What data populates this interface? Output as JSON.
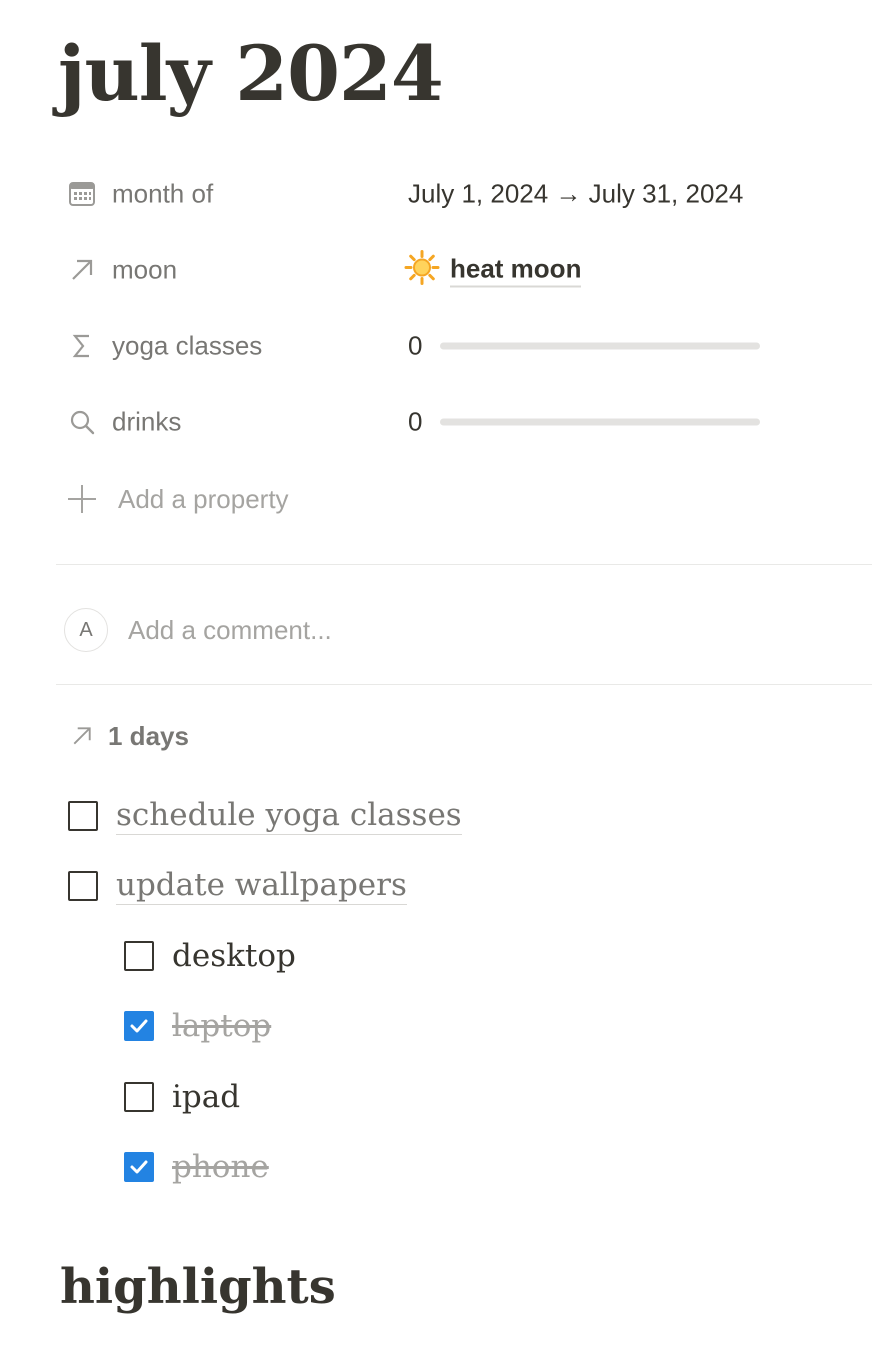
{
  "page": {
    "title": "july 2024"
  },
  "properties": [
    {
      "icon": "calendar-icon",
      "name": "month of",
      "value": "July 1, 2024 → July 31, 2024"
    },
    {
      "icon": "arrow-up-right-icon",
      "name": "moon",
      "emoji": "🔆",
      "value": "heat moon"
    },
    {
      "icon": "sigma-icon",
      "name": "yoga classes",
      "value": "0",
      "progress": 0
    },
    {
      "icon": "search-icon",
      "name": "drinks",
      "value": "0",
      "progress": 0
    }
  ],
  "add_property": {
    "label": "Add a property"
  },
  "comment": {
    "avatar_initial": "A",
    "placeholder": "Add a comment..."
  },
  "backlinks": {
    "label": "1 days"
  },
  "todos": [
    {
      "text": "schedule yoga classes",
      "checked": false,
      "linked": true,
      "indent": 0
    },
    {
      "text": "update wallpapers",
      "checked": false,
      "linked": true,
      "indent": 0
    },
    {
      "text": "desktop",
      "checked": false,
      "linked": false,
      "indent": 1
    },
    {
      "text": "laptop",
      "checked": true,
      "linked": false,
      "indent": 1
    },
    {
      "text": "ipad",
      "checked": false,
      "linked": false,
      "indent": 1
    },
    {
      "text": "phone",
      "checked": true,
      "linked": false,
      "indent": 1
    }
  ],
  "sections": {
    "highlights": "highlights"
  },
  "colors": {
    "text": "#37352f",
    "muted": "#787774",
    "placeholder": "#a5a4a1",
    "checkbox_checked": "#2383e2",
    "divider": "#e9e9e7"
  }
}
